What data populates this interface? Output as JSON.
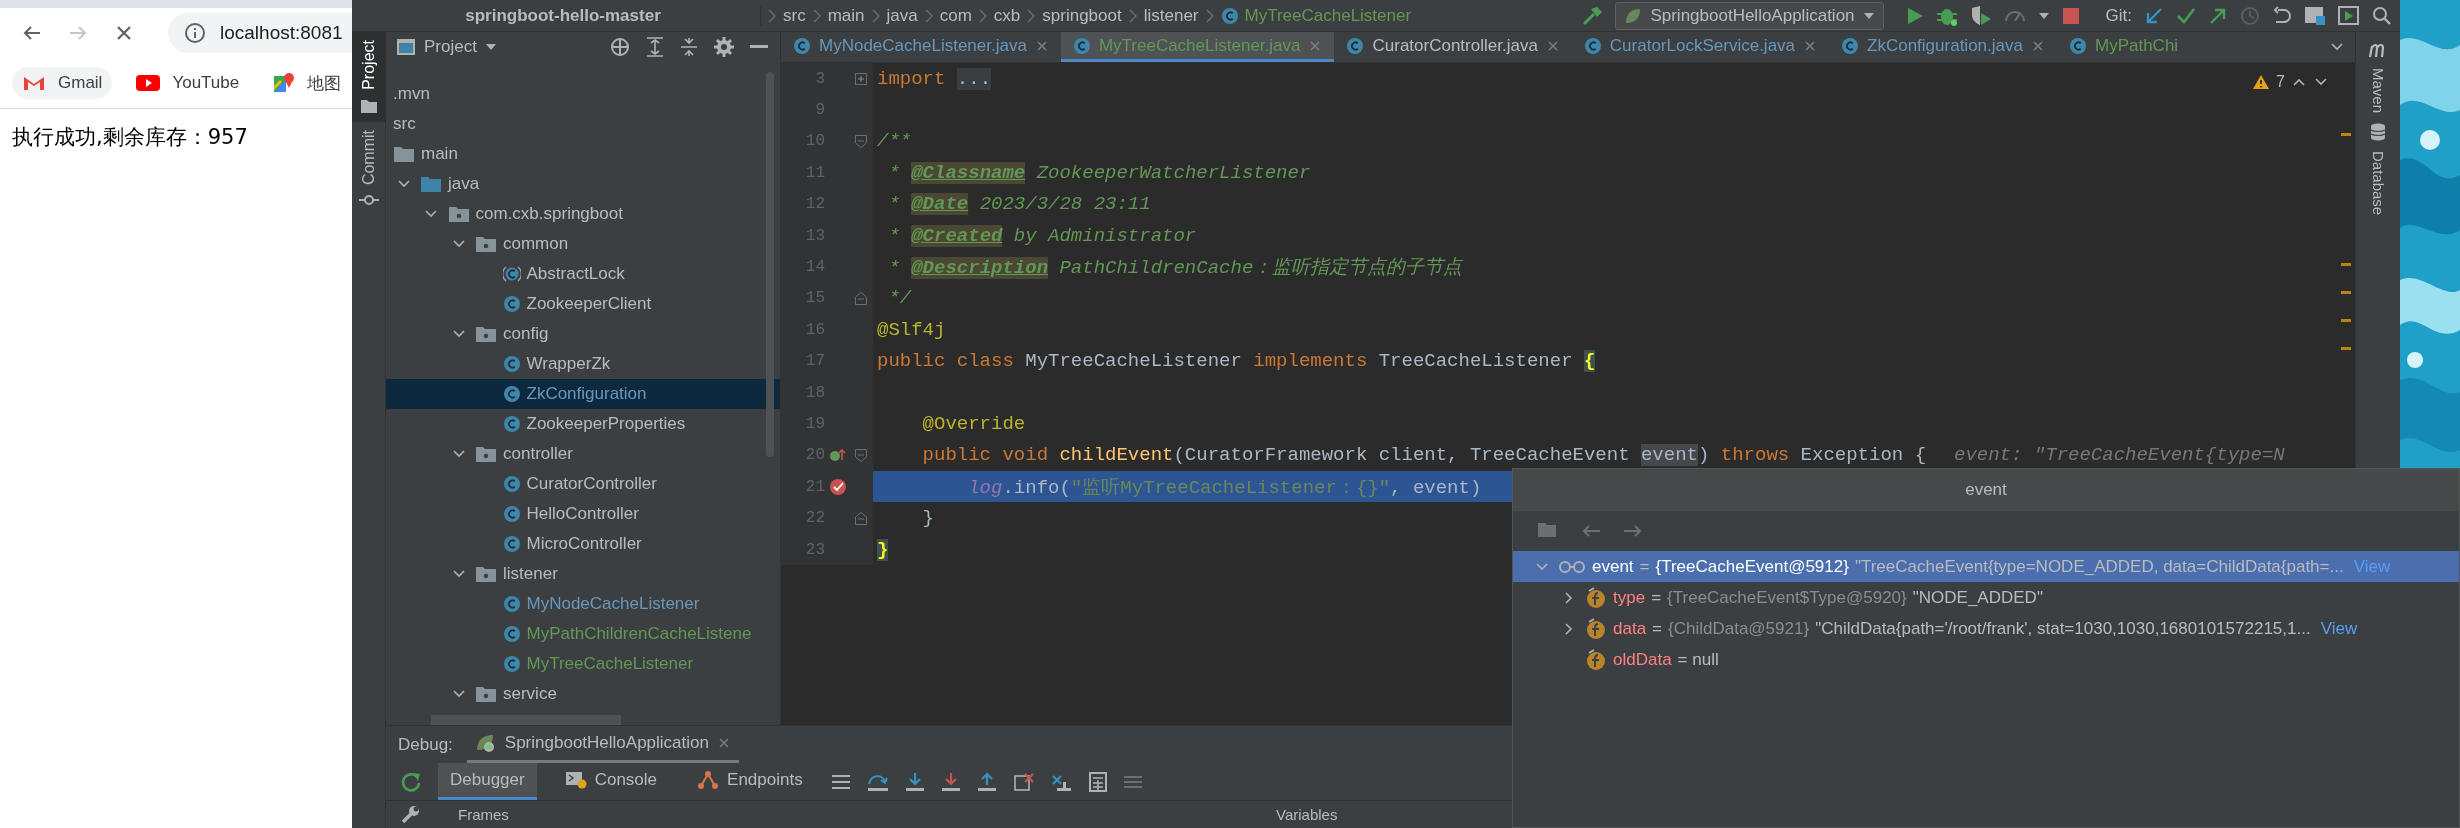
{
  "browser": {
    "nav": [
      {
        "kind": "back",
        "disabled": false
      },
      {
        "kind": "forward",
        "disabled": true
      },
      {
        "kind": "stop",
        "disabled": false
      }
    ],
    "url": "localhost:8081",
    "bookmarks": [
      {
        "label": "Gmail",
        "kind": "gmail",
        "highlighted": true
      },
      {
        "label": "YouTube",
        "kind": "youtube",
        "highlighted": false
      },
      {
        "label": "地图",
        "kind": "maps",
        "highlighted": false
      }
    ],
    "message": "执行成功,剩余库存：957"
  },
  "ide": {
    "breadcrumbs": [
      {
        "label": "springboot-hello-master",
        "kind": "project"
      },
      {
        "label": "src",
        "kind": "folder"
      },
      {
        "label": "main",
        "kind": "folder"
      },
      {
        "label": "java",
        "kind": "folder"
      },
      {
        "label": "com",
        "kind": "folder"
      },
      {
        "label": "cxb",
        "kind": "folder"
      },
      {
        "label": "springboot",
        "kind": "folder"
      },
      {
        "label": "listener",
        "kind": "folder"
      },
      {
        "label": "MyTreeCacheListener",
        "kind": "class"
      }
    ],
    "run_config": "SpringbootHelloApplication",
    "git_label": "Git:",
    "left_tabs": [
      {
        "label": "Project",
        "kind": "project",
        "selected": true
      },
      {
        "label": "Commit",
        "kind": "commit",
        "selected": false
      }
    ],
    "right_tabs": [
      {
        "label": "Maven",
        "kind": "maven"
      },
      {
        "label": "Database",
        "kind": "database"
      }
    ],
    "project": {
      "title": "Project",
      "tree": [
        {
          "label": ".mvn",
          "kind": "none",
          "selected": false
        },
        {
          "label": "src",
          "kind": "none",
          "selected": false
        },
        {
          "label": "main",
          "kind": "folder",
          "selected": false
        },
        {
          "label": "java",
          "kind": "source_folder",
          "expanded": true,
          "selected": false,
          "children": [
            {
              "label": "com.cxb.springboot",
              "kind": "package",
              "expanded": true,
              "selected": false,
              "children": [
                {
                  "label": "common",
                  "kind": "package",
                  "expanded": true,
                  "selected": false,
                  "children": [
                    {
                      "label": "AbstractLock",
                      "kind": "abstract_class",
                      "color": "#bbbbbb",
                      "selected": false
                    },
                    {
                      "label": "ZookeeperClient",
                      "kind": "class",
                      "color": "#bbbbbb",
                      "selected": false
                    }
                  ]
                },
                {
                  "label": "config",
                  "kind": "package",
                  "expanded": true,
                  "selected": false,
                  "children": [
                    {
                      "label": "WrapperZk",
                      "kind": "class",
                      "color": "#bbbbbb",
                      "selected": false
                    },
                    {
                      "label": "ZkConfiguration",
                      "kind": "class",
                      "color": "#6897bb",
                      "selected": true
                    },
                    {
                      "label": "ZookeeperProperties",
                      "kind": "class",
                      "color": "#bbbbbb",
                      "selected": false
                    }
                  ]
                },
                {
                  "label": "controller",
                  "kind": "package",
                  "expanded": true,
                  "selected": false,
                  "children": [
                    {
                      "label": "CuratorController",
                      "kind": "class",
                      "color": "#bbbbbb",
                      "selected": false
                    },
                    {
                      "label": "HelloController",
                      "kind": "class",
                      "color": "#bbbbbb",
                      "selected": false
                    },
                    {
                      "label": "MicroController",
                      "kind": "class",
                      "color": "#bbbbbb",
                      "selected": false
                    }
                  ]
                },
                {
                  "label": "listener",
                  "kind": "package",
                  "expanded": true,
                  "selected": false,
                  "children": [
                    {
                      "label": "MyNodeCacheListener",
                      "kind": "class",
                      "color": "#6897bb",
                      "selected": false
                    },
                    {
                      "label": "MyPathChildrenCacheListene",
                      "kind": "class",
                      "color": "#629755",
                      "selected": false
                    },
                    {
                      "label": "MyTreeCacheListener",
                      "kind": "class",
                      "color": "#629755",
                      "selected": false
                    }
                  ]
                },
                {
                  "label": "service",
                  "kind": "package",
                  "expanded": true,
                  "selected": false
                }
              ]
            }
          ]
        }
      ]
    },
    "editor": {
      "tabs": [
        {
          "label": "MyNodeCacheListener.java",
          "color": "#6897bb",
          "selected": false,
          "closable": true
        },
        {
          "label": "MyTreeCacheListener.java",
          "color": "#629755",
          "selected": true,
          "closable": true
        },
        {
          "label": "CuratorController.java",
          "color": "#bbbbbb",
          "selected": false,
          "closable": true
        },
        {
          "label": "CuratorLockService.java",
          "color": "#6897bb",
          "selected": false,
          "closable": true
        },
        {
          "label": "ZkConfiguration.java",
          "color": "#6897bb",
          "selected": false,
          "closable": true
        },
        {
          "label": "MyPathChi",
          "color": "#629755",
          "selected": false,
          "closable": false
        }
      ],
      "warnings": "7",
      "lines": [
        {
          "number": "3",
          "fold": {
            "kind": "collapsed"
          },
          "current": false,
          "tokens": [
            {
              "text": "import ",
              "kind": "keyword"
            },
            {
              "text": "...",
              "kind": "folded"
            }
          ]
        },
        {
          "number": "9",
          "current": false
        },
        {
          "number": "10",
          "fold": {
            "kind": "start"
          },
          "current": false,
          "tokens": [
            {
              "text": "/**",
              "kind": "comment"
            }
          ]
        },
        {
          "number": "11",
          "current": false,
          "tokens": [
            {
              "text": " * ",
              "kind": "comment"
            },
            {
              "text": "@Classname",
              "kind": "doctag"
            },
            {
              "text": " ZookeeperWatcherListener",
              "kind": "comment"
            }
          ]
        },
        {
          "number": "12",
          "current": false,
          "tokens": [
            {
              "text": " * ",
              "kind": "comment"
            },
            {
              "text": "@Date",
              "kind": "doctag"
            },
            {
              "text": " 2023/3/28 23:11",
              "kind": "comment"
            }
          ]
        },
        {
          "number": "13",
          "current": false,
          "tokens": [
            {
              "text": " * ",
              "kind": "comment"
            },
            {
              "text": "@Created",
              "kind": "doctag"
            },
            {
              "text": " by Administrator",
              "kind": "comment"
            }
          ]
        },
        {
          "number": "14",
          "current": false,
          "tokens": [
            {
              "text": " * ",
              "kind": "comment"
            },
            {
              "text": "@Description",
              "kind": "doctag"
            },
            {
              "text": " PathChildrenCache：监听指定节点的子节点",
              "kind": "comment"
            }
          ]
        },
        {
          "number": "15",
          "fold": {
            "kind": "end"
          },
          "current": false,
          "tokens": [
            {
              "text": " */",
              "kind": "comment"
            }
          ]
        },
        {
          "number": "16",
          "current": false,
          "tokens": [
            {
              "text": "@Slf4j",
              "kind": "annotation"
            }
          ]
        },
        {
          "number": "17",
          "current": false,
          "tokens": [
            {
              "text": "public class ",
              "kind": "keyword"
            },
            {
              "text": "MyTreeCacheListener ",
              "kind": "plain"
            },
            {
              "text": "implements ",
              "kind": "keyword"
            },
            {
              "text": "TreeCacheListener ",
              "kind": "plain"
            },
            {
              "text": "{",
              "kind": "brace"
            }
          ]
        },
        {
          "number": "18",
          "current": false
        },
        {
          "number": "19",
          "current": false,
          "tokens": [
            {
              "text": "    @Override",
              "kind": "annotation"
            }
          ]
        },
        {
          "number": "20",
          "fold": {
            "kind": "start"
          },
          "marker": {
            "kind": "override"
          },
          "current": false,
          "tokens": [
            {
              "text": "    public void ",
              "kind": "keyword"
            },
            {
              "text": "childEvent",
              "kind": "method"
            },
            {
              "text": "(CuratorFramework client, TreeCacheEvent ",
              "kind": "plain"
            },
            {
              "text": "event",
              "kind": "usage"
            },
            {
              "text": ") ",
              "kind": "plain"
            },
            {
              "text": "throws ",
              "kind": "keyword"
            },
            {
              "text": "Exception {",
              "kind": "plain"
            },
            {
              "text": "event: \"TreeCacheEvent{type=N",
              "kind": "hint"
            }
          ]
        },
        {
          "number": "21",
          "marker": {
            "kind": "breakpoint"
          },
          "current": true,
          "tokens": [
            {
              "text": "        log",
              "kind": "static"
            },
            {
              "text": ".info(",
              "kind": "plain"
            },
            {
              "text": "\"监听MyTreeCacheListener：{}\"",
              "kind": "string"
            },
            {
              "text": ", event)",
              "kind": "plain"
            }
          ]
        },
        {
          "number": "22",
          "fold": {
            "kind": "end"
          },
          "current": false,
          "tokens": [
            {
              "text": "    }",
              "kind": "plain"
            }
          ]
        },
        {
          "number": "23",
          "current": false,
          "tokens": [
            {
              "text": "}",
              "kind": "brace"
            }
          ]
        }
      ]
    },
    "debug": {
      "label": "Debug:",
      "session": "SpringbootHelloApplication",
      "tabs": [
        {
          "label": "Debugger",
          "kind": "debugger",
          "selected": true
        },
        {
          "label": "Console",
          "kind": "console",
          "selected": false
        },
        {
          "label": "Endpoints",
          "kind": "endpoints",
          "selected": false
        }
      ],
      "frames_title": "Frames",
      "variables_title": "Variables"
    }
  },
  "popup": {
    "title": "event",
    "nodes": [
      {
        "name": "event",
        "kind": "watch",
        "expanded": true,
        "selected": true,
        "operator": "=",
        "ref": "{TreeCacheEvent@5912}",
        "value": "\"TreeCacheEvent{type=NODE_ADDED, data=ChildData{path=...",
        "link": "View",
        "children": [
          {
            "name": "type",
            "kind": "field",
            "expanded": false,
            "selected": false,
            "operator": "=",
            "ref": "{TreeCacheEvent$Type@5920}",
            "value": "\"NODE_ADDED\""
          },
          {
            "name": "data",
            "kind": "field",
            "expanded": false,
            "selected": false,
            "operator": "=",
            "ref": "{ChildData@5921}",
            "value": "\"ChildData{path='/root/frank', stat=1030,1030,1680101572215,1...",
            "link": "View"
          },
          {
            "name": "oldData",
            "kind": "field",
            "selected": false,
            "operator": "=",
            "value": "null"
          }
        ]
      }
    ]
  }
}
